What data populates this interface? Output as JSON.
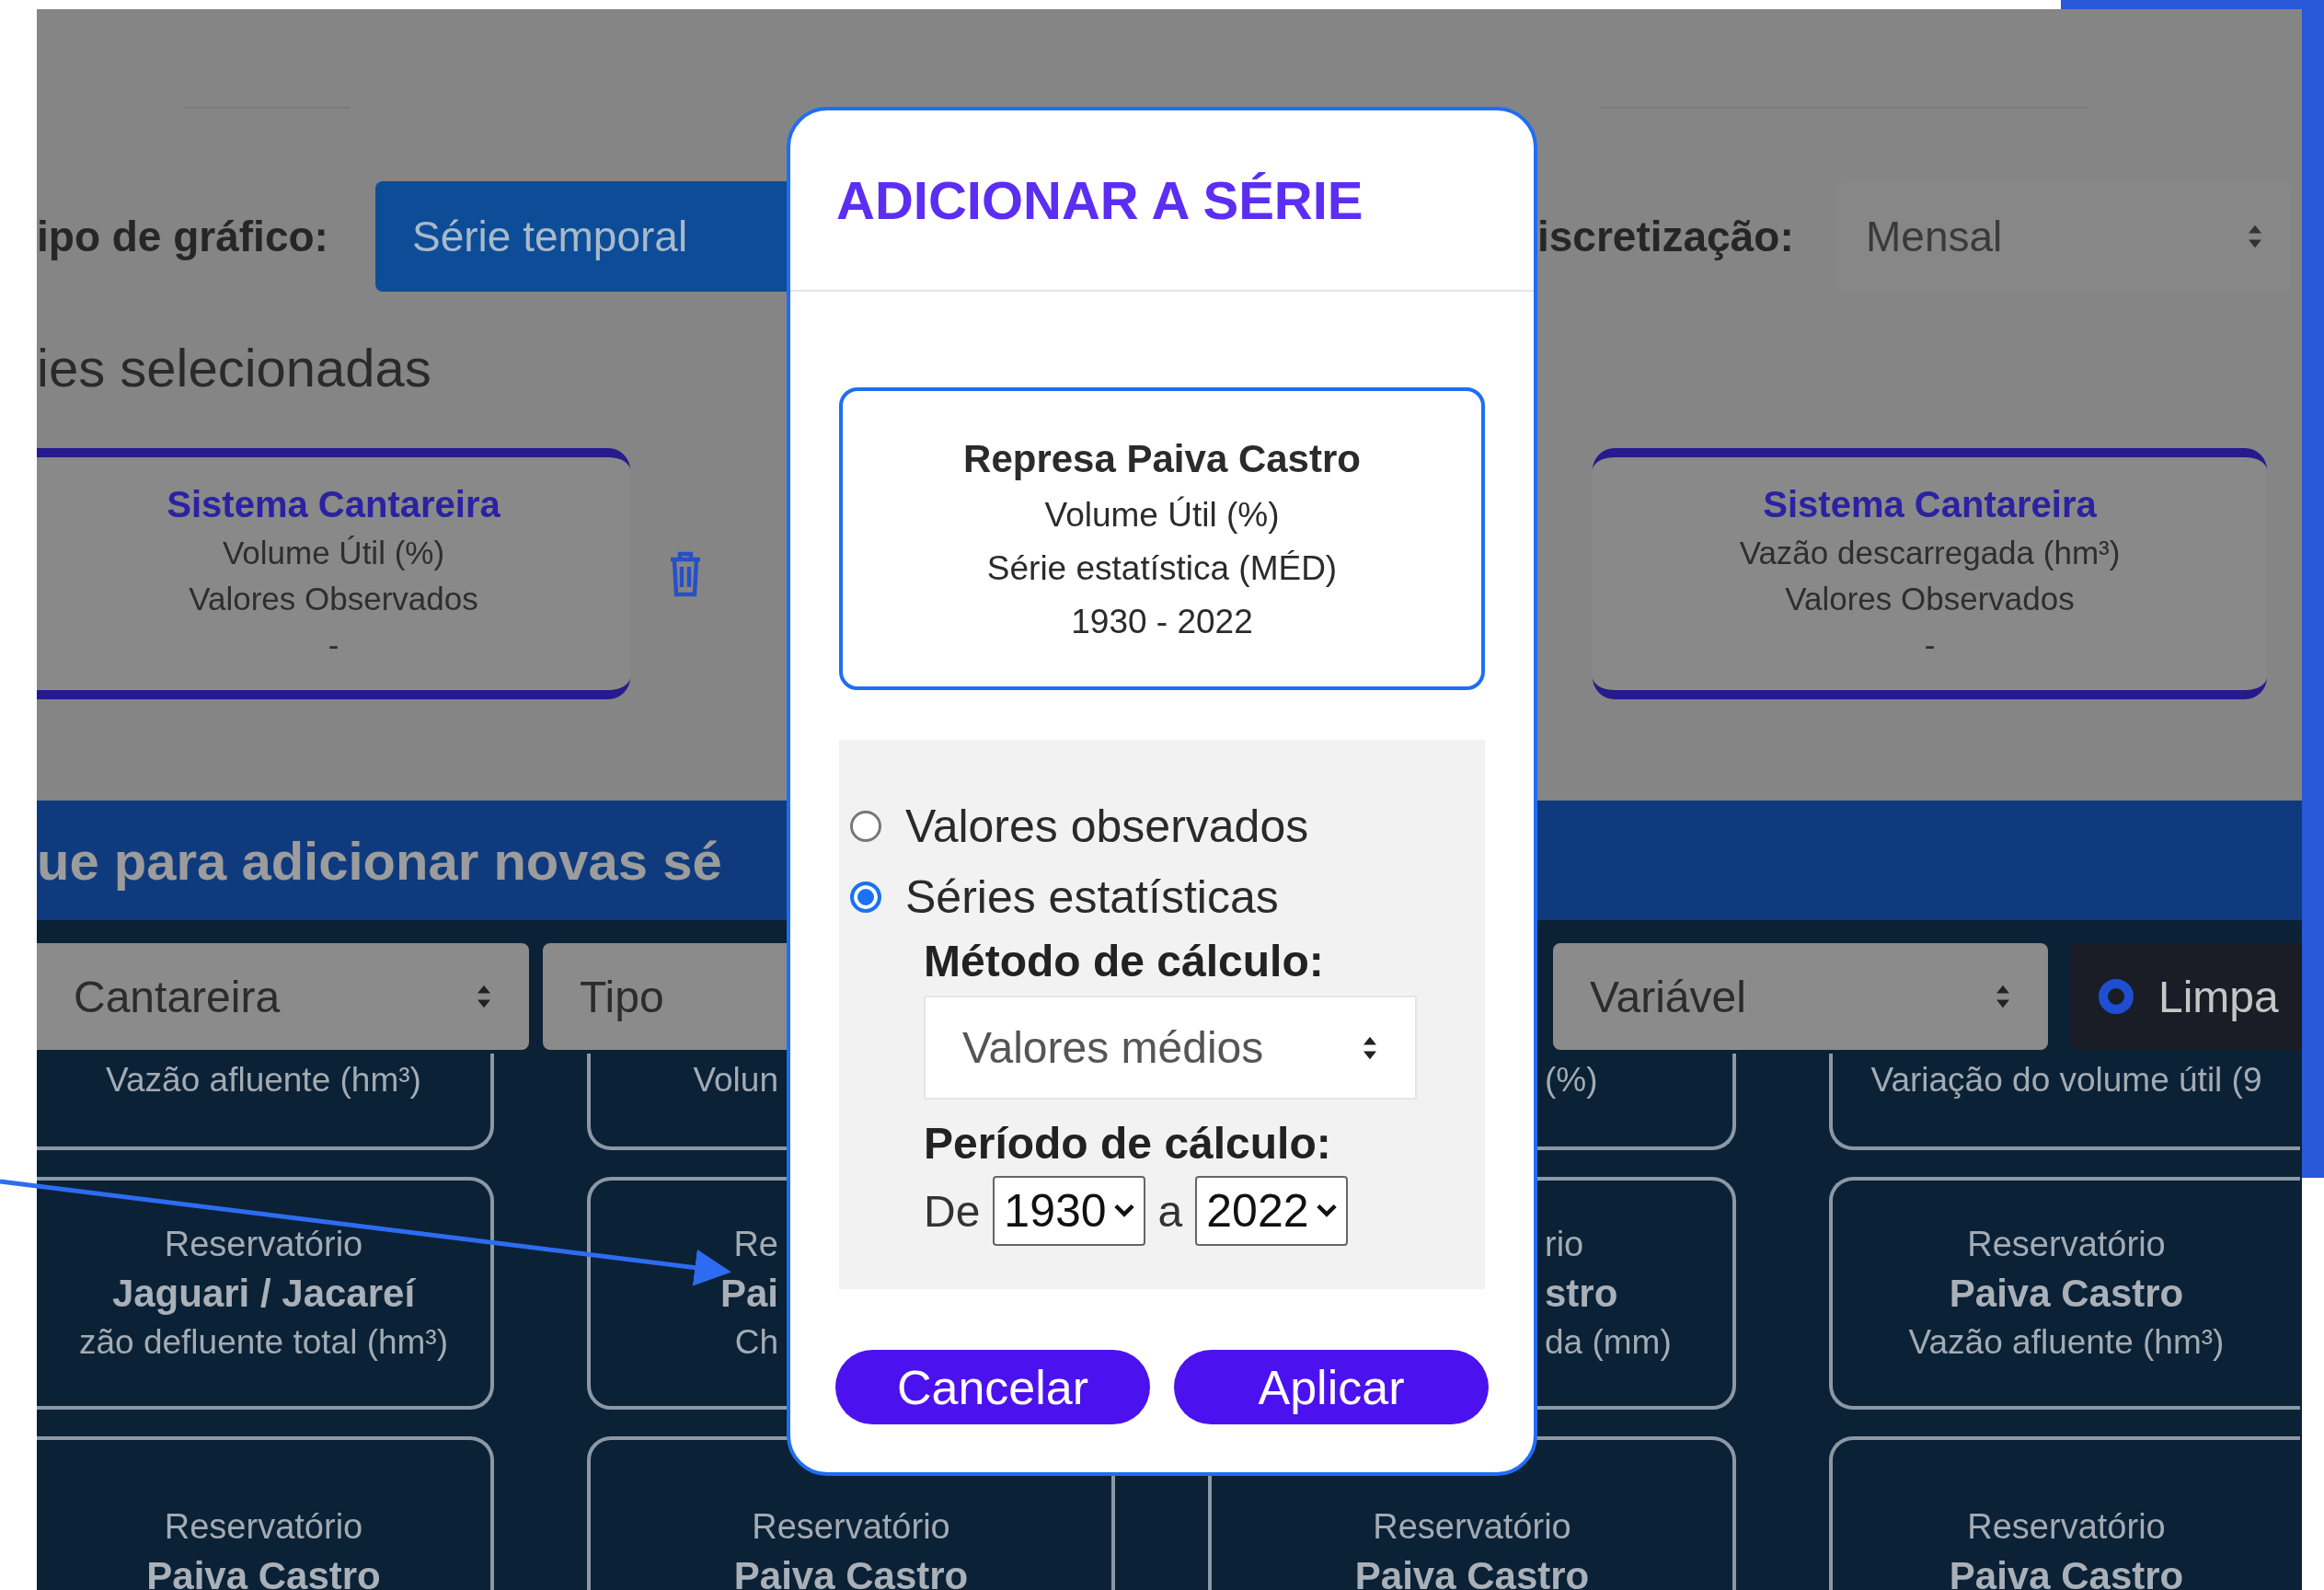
{
  "top_bar": {
    "chart_type_label": "ipo de gráfico:",
    "chart_type_button": "Série temporal",
    "discretization_label": "iscretização:",
    "discretization_value": "Mensal"
  },
  "selected_heading": "ies selecionadas",
  "selected_series": [
    {
      "title": "Sistema Cantareira",
      "variable": "Volume Útil (%)",
      "data_type": "Valores Observados",
      "period": "-"
    },
    {
      "title": "Sistema Cantareira",
      "variable": "Vazão descarregada (hm³)",
      "data_type": "Valores Observados",
      "period": "-"
    }
  ],
  "add_banner": "ue para adicionar novas sé",
  "filters": [
    {
      "kind": "select",
      "value": "Cantareira"
    },
    {
      "kind": "select",
      "value": "Tipo"
    },
    {
      "kind": "select",
      "value": "Variável"
    },
    {
      "kind": "button",
      "label": "Limpa"
    }
  ],
  "series_grid": {
    "rows": [
      [
        {
          "variable": "Vazão afluente (hm³)"
        },
        {
          "variable": "Volun"
        },
        {
          "variable": "(%)"
        },
        {
          "variable": "Variação do volume útil (9"
        }
      ],
      [
        {
          "category": "Reservatório",
          "name": "Jaguari / Jacareí",
          "variable": "zão defluente total (hm³)"
        },
        {
          "category": "Re",
          "name": "Pai",
          "variable": "Ch"
        },
        {
          "category": "rio",
          "name": "stro",
          "variable": "da (mm)"
        },
        {
          "category": "Reservatório",
          "name": "Paiva Castro",
          "variable": "Vazão afluente (hm³)"
        }
      ],
      [
        {
          "category": "Reservatório",
          "name": "Paiva Castro"
        },
        {
          "category": "Reservatório",
          "name": "Paiva Castro"
        },
        {
          "category": "Reservatório",
          "name": "Paiva Castro"
        },
        {
          "category": "Reservatório",
          "name": "Paiva Castro"
        }
      ]
    ]
  },
  "dialog": {
    "title": "ADICIONAR A SÉRIE",
    "summary": {
      "name": "Represa Paiva Castro",
      "variable": "Volume Útil (%)",
      "series": "Série estatística (MÉD)",
      "period": "1930 - 2022"
    },
    "options": [
      {
        "label": "Valores observados",
        "selected": false
      },
      {
        "label": "Séries estatísticas",
        "selected": true
      }
    ],
    "method_label": "Método de cálculo:",
    "method_value": "Valores médios",
    "period_label": "Período de cálculo:",
    "from_label": "De",
    "from_value": "1930",
    "to_label": "a",
    "to_value": "2022",
    "buttons": [
      {
        "label": "Cancelar"
      },
      {
        "label": "Aplicar"
      }
    ]
  }
}
